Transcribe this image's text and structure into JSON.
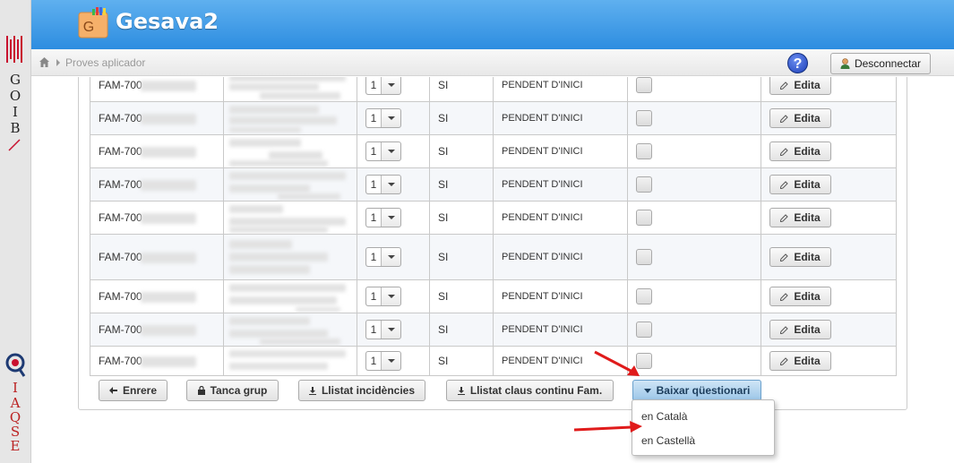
{
  "sidebar": {
    "goib_letters": [
      "G",
      "O",
      "I",
      "B"
    ],
    "iaqse_letters": [
      "I",
      "A",
      "Q",
      "S",
      "E"
    ]
  },
  "header": {
    "logo_letter": "G",
    "app_title": "Gesava2"
  },
  "breadcrumb": {
    "items": [
      "Proves aplicador"
    ]
  },
  "user_bar": {
    "help_label": "?",
    "disconnect_label": "Desconnectar"
  },
  "table": {
    "rows": [
      {
        "code": "FAM-700",
        "select_value": "1",
        "yes": "SI",
        "status": "PENDENT D'INICI",
        "edit": "Edita"
      },
      {
        "code": "FAM-700",
        "select_value": "1",
        "yes": "SI",
        "status": "PENDENT D'INICI",
        "edit": "Edita"
      },
      {
        "code": "FAM-700",
        "select_value": "1",
        "yes": "SI",
        "status": "PENDENT D'INICI",
        "edit": "Edita"
      },
      {
        "code": "FAM-700",
        "select_value": "1",
        "yes": "SI",
        "status": "PENDENT D'INICI",
        "edit": "Edita"
      },
      {
        "code": "FAM-700",
        "select_value": "1",
        "yes": "SI",
        "status": "PENDENT D'INICI",
        "edit": "Edita"
      },
      {
        "code": "FAM-700",
        "select_value": "1",
        "yes": "SI",
        "status": "PENDENT D'INICI",
        "edit": "Edita"
      },
      {
        "code": "FAM-700",
        "select_value": "1",
        "yes": "SI",
        "status": "PENDENT D'INICI",
        "edit": "Edita"
      },
      {
        "code": "FAM-700",
        "select_value": "1",
        "yes": "SI",
        "status": "PENDENT D'INICI",
        "edit": "Edita"
      },
      {
        "code": "FAM-700",
        "select_value": "1",
        "yes": "SI",
        "status": "PENDENT D'INICI",
        "edit": "Edita"
      }
    ]
  },
  "actions": {
    "back": "Enrere",
    "close_group": "Tanca grup",
    "incidents": "Llistat incidències",
    "keys_list": "Llistat claus continu Fam.",
    "download": "Baixar qüestionari"
  },
  "download_menu": {
    "items": [
      "en Català",
      "en Castellà"
    ]
  },
  "colors": {
    "header_blue": "#2d8de0",
    "primary_button": "#9cc6e8",
    "annotation_red": "#e01b1b"
  }
}
